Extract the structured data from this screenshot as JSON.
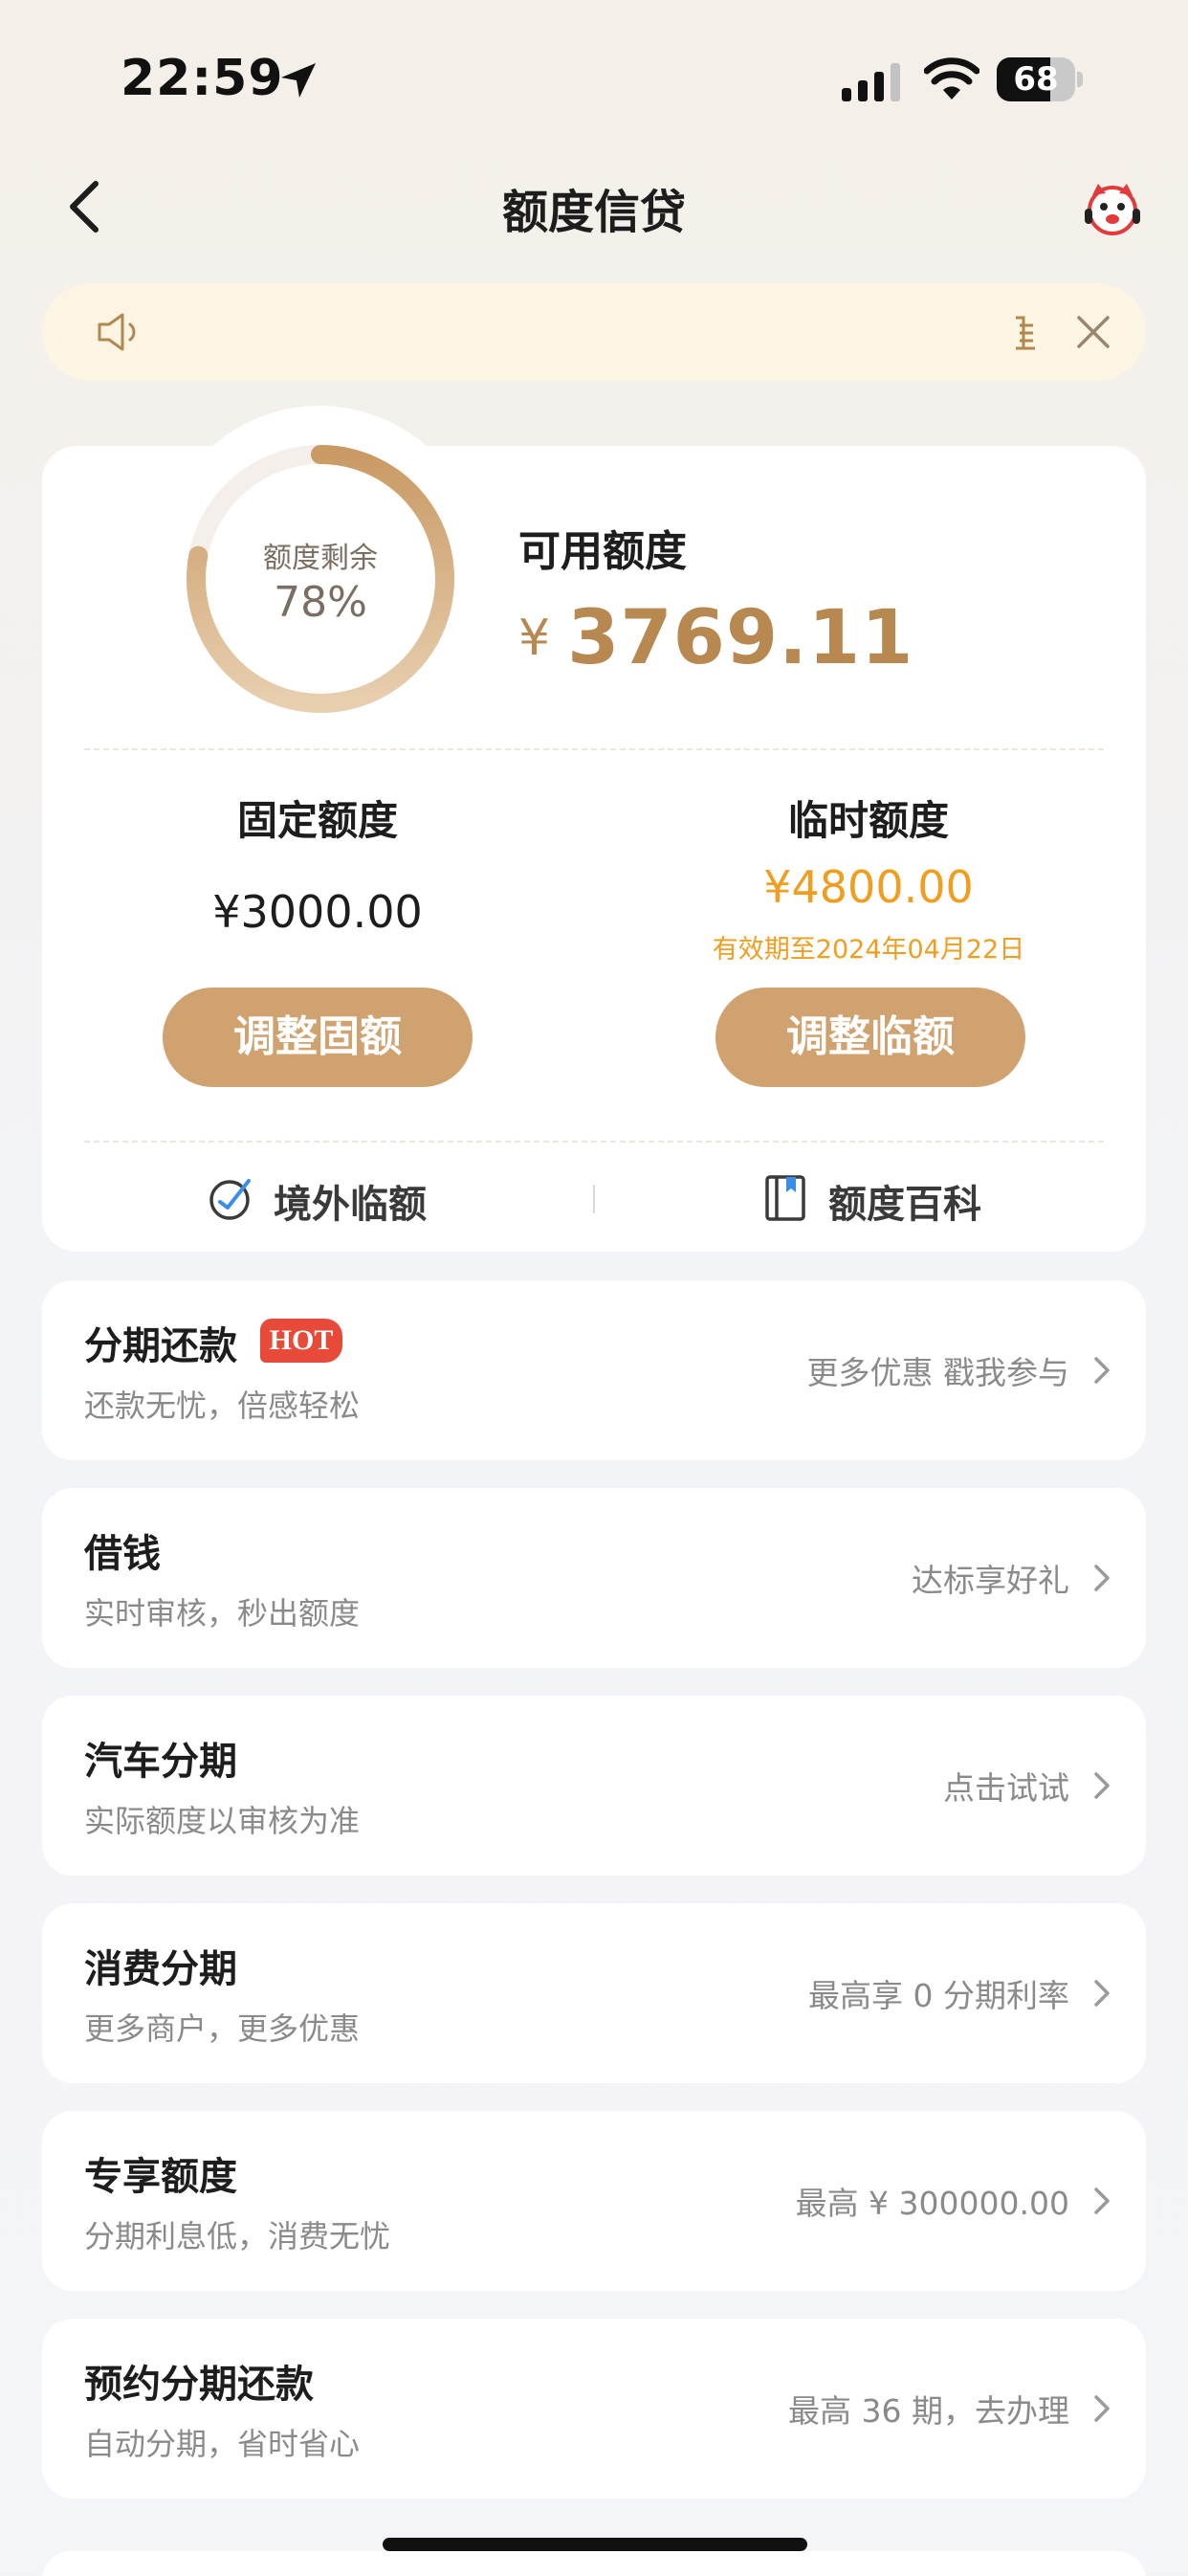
{
  "status_bar": {
    "time": "22:59",
    "battery": "68",
    "battery_level": 0.68
  },
  "nav": {
    "title": "额度信贷"
  },
  "notice": {
    "text": ""
  },
  "credit": {
    "ring_label": "额度剩余",
    "ring_percent": "78%",
    "ring_fraction": 0.78,
    "available_label": "可用额度",
    "currency": "¥",
    "available_amount": "3769.11",
    "fixed": {
      "title": "固定额度",
      "amount": "¥3000.00",
      "button": "调整固额"
    },
    "temp": {
      "title": "临时额度",
      "amount": "¥4800.00",
      "expiry": "有效期至2024年04月22日",
      "button": "调整临额"
    },
    "links": [
      {
        "label": "境外临额",
        "icon": "overseas-plane-icon"
      },
      {
        "label": "额度百科",
        "icon": "book-icon"
      }
    ]
  },
  "list": [
    {
      "title": "分期还款",
      "badge": "HOT",
      "subtitle": "还款无忧，倍感轻松",
      "promo": "更多优惠 戳我参与"
    },
    {
      "title": "借钱",
      "subtitle": "实时审核，秒出额度",
      "promo": "达标享好礼"
    },
    {
      "title": "汽车分期",
      "subtitle": "实际额度以审核为准",
      "promo": "点击试试"
    },
    {
      "title": "消费分期",
      "subtitle": "更多商户，更多优惠",
      "promo": "最高享 0 分期利率"
    },
    {
      "title": "专享额度",
      "subtitle": "分期利息低，消费无忧",
      "promo": "最高 ¥ 300000.00"
    },
    {
      "title": "预约分期还款",
      "subtitle": "自动分期，省时省心",
      "promo": "最高 36 期，去办理"
    }
  ],
  "colors": {
    "accent_gold": "#cfa26f",
    "amount_gold": "#b78850",
    "temp_orange": "#ef9e1f",
    "hot_red": "#e84a3a",
    "notice_bg": "#fdf5e4"
  }
}
